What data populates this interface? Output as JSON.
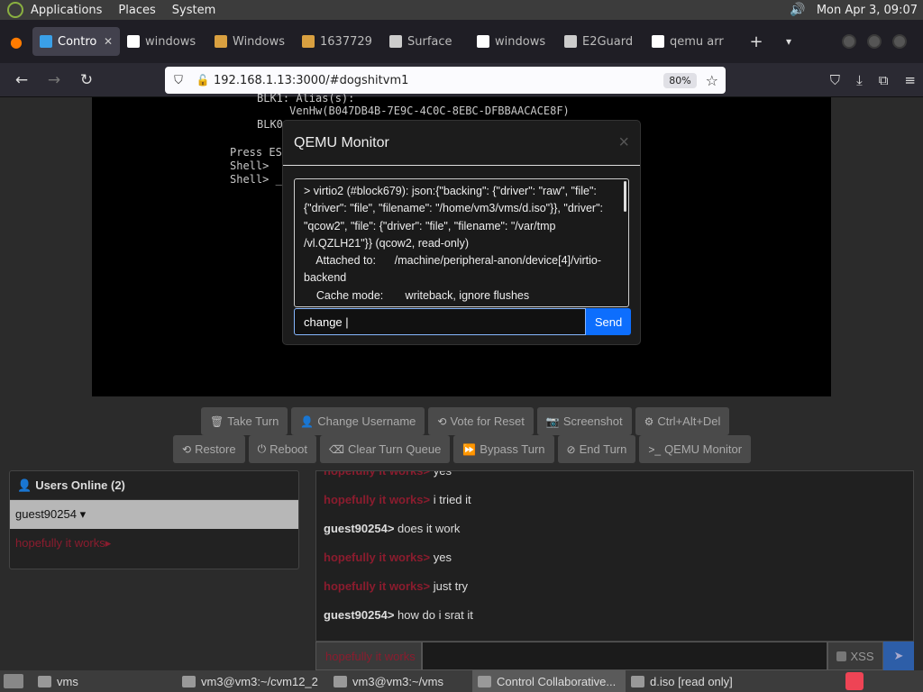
{
  "top_panel": {
    "menus": [
      "Applications",
      "Places",
      "System"
    ],
    "clock": "Mon Apr  3, 09:07"
  },
  "tabs": [
    {
      "label": "Contro",
      "icon": "monitor-icon",
      "color": "#3aa0e8"
    },
    {
      "label": "windows",
      "icon": "google-icon",
      "color": "#ffffff"
    },
    {
      "label": "Windows",
      "icon": "ba-icon",
      "color": "#d9a040"
    },
    {
      "label": "1637729",
      "icon": "ba-icon",
      "color": "#d9a040"
    },
    {
      "label": "Surface",
      "icon": "museum-icon",
      "color": "#cccccc"
    },
    {
      "label": "windows",
      "icon": "google-icon",
      "color": "#ffffff"
    },
    {
      "label": "E2Guard",
      "icon": "museum-icon",
      "color": "#cccccc"
    },
    {
      "label": "qemu arr",
      "icon": "google-icon",
      "color": "#ffffff"
    }
  ],
  "navbar": {
    "url": "192.168.1.13:3000/#dogshitvm1",
    "zoom": "80%"
  },
  "vm_screen": {
    "lines": [
      "BLK1: Alias(s):",
      "     VenHw(B047DB4B-7E9C-4C0C-8EBC-DFBBAACACE8F)",
      "BLK0",
      "Press ESC",
      "Shell>",
      "Shell> _"
    ]
  },
  "qemu_modal": {
    "title": "QEMU Monitor",
    "close": "×",
    "output_lines": [
      "> virtio2 (#block679): json:{\"backing\": {\"driver\": \"raw\", \"file\":",
      "{\"driver\": \"file\", \"filename\": \"/home/vm3/vms/d.iso\"}}, \"driver\":",
      "\"qcow2\", \"file\": {\"driver\": \"file\", \"filename\": \"/var/tmp",
      "/vl.QZLH21\"}} (qcow2, read-only)",
      "    Attached to:      /machine/peripheral-anon/device[4]/virtio-",
      "backend",
      "    Cache mode:       writeback, ignore flushes"
    ],
    "command_value": "change |",
    "send_label": "Send"
  },
  "actions_row1": [
    {
      "label": "Take Turn",
      "icon": "trash-icon",
      "glyph": "🗑"
    },
    {
      "label": "Change Username",
      "icon": "user-icon",
      "glyph": "👤"
    },
    {
      "label": "Vote for Reset",
      "icon": "undo-icon",
      "glyph": "⟲"
    },
    {
      "label": "Screenshot",
      "icon": "camera-icon",
      "glyph": "📷"
    },
    {
      "label": "Ctrl+Alt+Del",
      "icon": "gear-icon",
      "glyph": "⚙"
    }
  ],
  "actions_row2": [
    {
      "label": "Restore",
      "icon": "restore-icon",
      "glyph": "⟲"
    },
    {
      "label": "Reboot",
      "icon": "power-icon",
      "glyph": "⏻"
    },
    {
      "label": "Clear Turn Queue",
      "icon": "eraser-icon",
      "glyph": "⌫"
    },
    {
      "label": "Bypass Turn",
      "icon": "fast-forward-icon",
      "glyph": "⏩"
    },
    {
      "label": "End Turn",
      "icon": "ban-icon",
      "glyph": "⊘"
    },
    {
      "label": "QEMU Monitor",
      "icon": "terminal-icon",
      "glyph": ">_"
    }
  ],
  "users_panel": {
    "title": "Users Online (2)",
    "users": [
      {
        "name": "guest90254 ▾",
        "self": true
      },
      {
        "name": "hopefully it works▸",
        "self": false
      }
    ]
  },
  "chat": {
    "messages": [
      {
        "user": "hopefully it works>",
        "text": "yes",
        "red": true
      },
      {
        "user": "hopefully it works>",
        "text": "i tried it",
        "red": true
      },
      {
        "user": "guest90254>",
        "text": "does it work",
        "red": false
      },
      {
        "user": "hopefully it works>",
        "text": "yes",
        "red": true
      },
      {
        "user": "hopefully it works>",
        "text": "just try",
        "red": true
      },
      {
        "user": "guest90254>",
        "text": "how do i srat it",
        "red": false
      }
    ],
    "nick": "hopefully it works",
    "xss_label": "XSS"
  },
  "taskbar": [
    {
      "label": "vms",
      "active": false
    },
    {
      "label": "vm3@vm3:~/cvm12_2",
      "active": false
    },
    {
      "label": "vm3@vm3:~/vms",
      "active": false
    },
    {
      "label": "Control Collaborative...",
      "active": true
    },
    {
      "label": "d.iso [read only]",
      "active": false
    }
  ]
}
